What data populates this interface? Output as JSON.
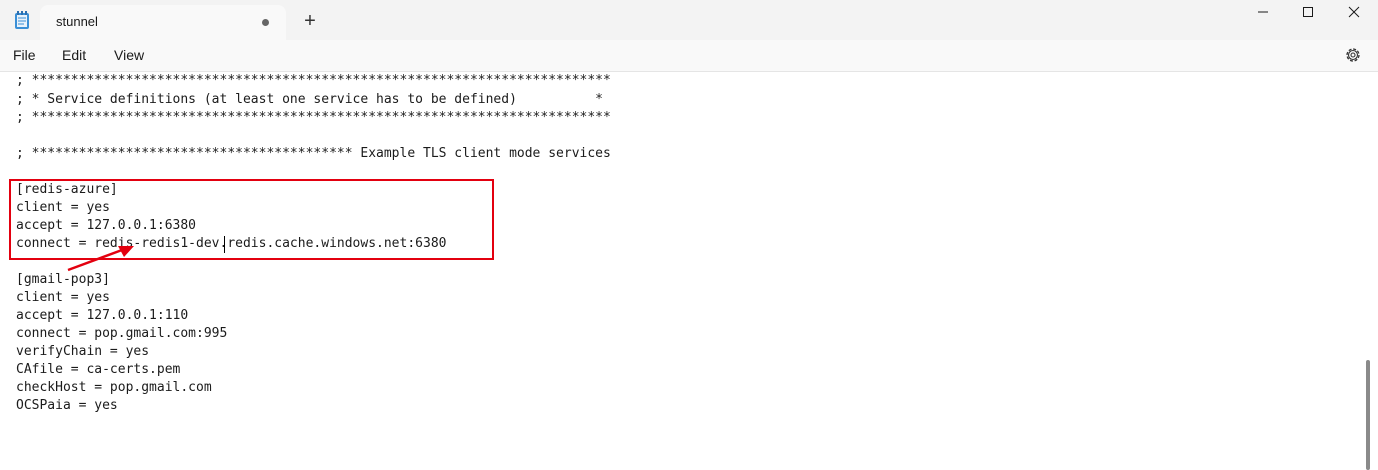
{
  "window": {
    "tab_title": "stunnel",
    "new_tab_symbol": "+",
    "unsaved_indicator": true
  },
  "menu": {
    "file": "File",
    "edit": "Edit",
    "view": "View"
  },
  "icons": {
    "app": "notepad-icon",
    "settings": "gear-icon",
    "minimize": "minimize-icon",
    "maximize": "maximize-icon",
    "close": "close-icon"
  },
  "editor": {
    "lines": [
      "; **************************************************************************",
      "; * Service definitions (at least one service has to be defined)          *",
      "; **************************************************************************",
      "",
      "; ***************************************** Example TLS client mode services",
      "",
      "[redis-azure]",
      "client = yes",
      "accept = 127.0.0.1:6380",
      "connect = redis-redis1-dev.redis.cache.windows.net:6380",
      "",
      "[gmail-pop3]",
      "client = yes",
      "accept = 127.0.0.1:110",
      "connect = pop.gmail.com:995",
      "verifyChain = yes",
      "CAfile = ca-certs.pem",
      "checkHost = pop.gmail.com",
      "OCSPaia = yes"
    ]
  },
  "annotation": {
    "color": "#e3000f"
  }
}
